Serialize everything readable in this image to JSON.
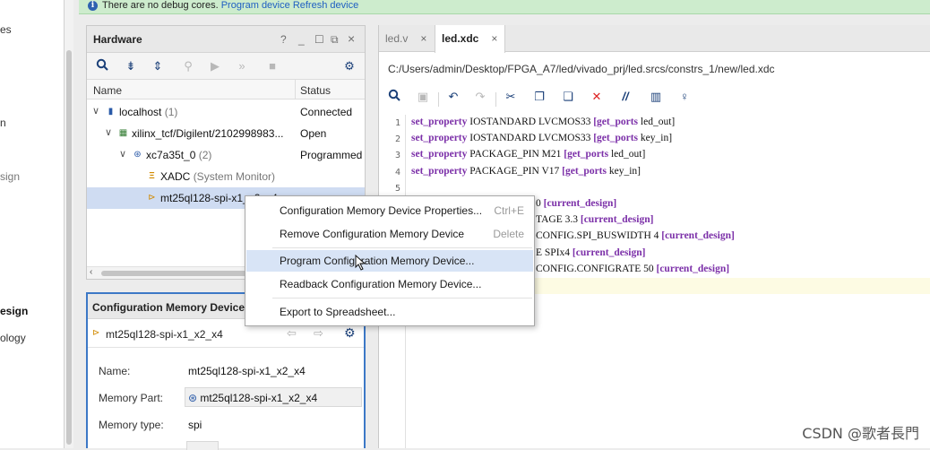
{
  "left_nav": {
    "fragments": [
      "es",
      "n",
      "sign",
      "esign",
      "ology"
    ]
  },
  "banner": {
    "message": "There are no debug cores.",
    "link1": "Program device",
    "link2": "Refresh device"
  },
  "hardware": {
    "title": "Hardware",
    "controls": [
      "?",
      "_",
      "☐",
      "⧉",
      "×"
    ],
    "columns": {
      "name": "Name",
      "status": "Status"
    },
    "rows": [
      {
        "name": "localhost",
        "suffix": "(1)",
        "status": "Connected"
      },
      {
        "name": "xilinx_tcf/Digilent/2102998983...",
        "suffix": "",
        "status": "Open"
      },
      {
        "name": "xc7a35t_0",
        "suffix": "(2)",
        "status": "Programmed"
      },
      {
        "name": "XADC",
        "suffix": "(System Monitor)",
        "status": ""
      },
      {
        "name": "mt25ql128-spi-x1_x2_x4",
        "suffix": "",
        "status": ""
      }
    ]
  },
  "properties": {
    "title": "Configuration Memory Device Pro",
    "device": "mt25ql128-spi-x1_x2_x4",
    "fields": [
      {
        "key": "Name:",
        "value": "mt25ql128-spi-x1_x2_x4"
      },
      {
        "key": "Memory Part:",
        "value": "mt25ql128-spi-x1_x2_x4"
      },
      {
        "key": "Memory type:",
        "value": "spi"
      }
    ]
  },
  "editor": {
    "tabs": [
      {
        "label": "led.v",
        "active": false
      },
      {
        "label": "led.xdc",
        "active": true
      }
    ],
    "path": "C:/Users/admin/Desktop/FPGA_A7/led/vivado_prj/led.srcs/constrs_1/new/led.xdc",
    "lines": [
      {
        "n": "1",
        "kw": "set_property",
        "mid": " IOSTANDARD LVCMOS33 ",
        "br": "[get_ports",
        "tail": " led_out]"
      },
      {
        "n": "2",
        "kw": "set_property",
        "mid": " IOSTANDARD LVCMOS33 ",
        "br": "[get_ports",
        "tail": " key_in]"
      },
      {
        "n": "3",
        "kw": "set_property",
        "mid": " PACKAGE_PIN M21 ",
        "br": "[get_ports",
        "tail": " led_out]"
      },
      {
        "n": "4",
        "kw": "set_property",
        "mid": " PACKAGE_PIN V17 ",
        "br": "[get_ports",
        "tail": " key_in]"
      },
      {
        "n": "5",
        "kw": "",
        "mid": "",
        "br": "",
        "tail": ""
      },
      {
        "n": "",
        "kw": "",
        "mid": "0 ",
        "br": "[current_design]",
        "tail": ""
      },
      {
        "n": "",
        "kw": "",
        "mid": "TAGE 3.3 ",
        "br": "[current_design]",
        "tail": ""
      },
      {
        "n": "",
        "kw": "",
        "mid": "CONFIG.SPI_BUSWIDTH 4 ",
        "br": "[current_design]",
        "tail": ""
      },
      {
        "n": "",
        "kw": "",
        "mid": "E SPIx4 ",
        "br": "[current_design]",
        "tail": ""
      },
      {
        "n": "",
        "kw": "",
        "mid": "CONFIG.CONFIGRATE 50 ",
        "br": "[current_design]",
        "tail": ""
      }
    ]
  },
  "context_menu": {
    "items": [
      {
        "label": "Configuration Memory Device Properties...",
        "shortcut": "Ctrl+E"
      },
      {
        "label": "Remove Configuration Memory Device",
        "shortcut": "Delete"
      },
      {
        "label": "Program Configuration Memory Device...",
        "shortcut": ""
      },
      {
        "label": "Readback Configuration Memory Device...",
        "shortcut": ""
      },
      {
        "label": "Export to Spreadsheet...",
        "shortcut": ""
      }
    ]
  },
  "watermark": "CSDN @歌者長門"
}
